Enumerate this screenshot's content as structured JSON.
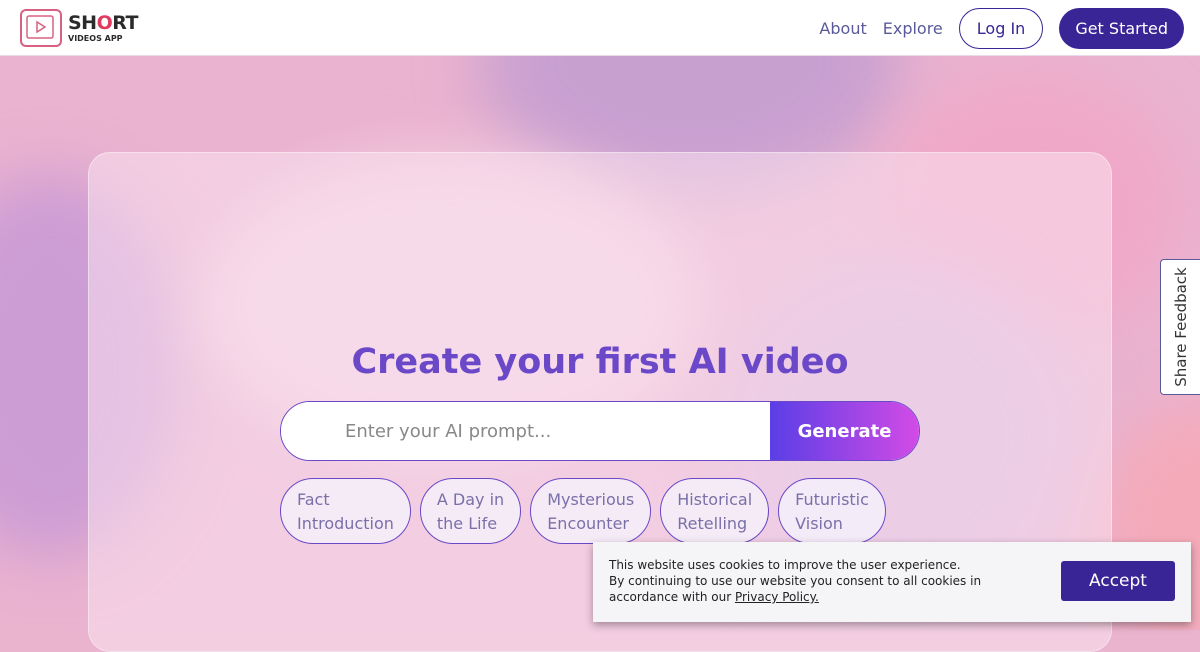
{
  "header": {
    "logo": {
      "word_main_pre": "SH",
      "word_main_accent": "O",
      "word_main_post": "RT",
      "word_sub": "VIDEOS APP"
    },
    "nav": {
      "about": "About",
      "explore": "Explore",
      "login": "Log In",
      "get_started": "Get Started"
    }
  },
  "hero": {
    "title": "Create your first AI video",
    "prompt_placeholder": "Enter your AI prompt...",
    "generate": "Generate",
    "chips": [
      "Fact\nIntroduction",
      "A Day in\nthe Life",
      "Mysterious\nEncounter",
      "Historical\nRetelling",
      "Futuristic\nVision"
    ]
  },
  "feedback": {
    "label": "Share Feedback"
  },
  "cookie": {
    "line1": "This website uses cookies to improve the user experience.",
    "line2": "By continuing to use our website you consent to all cookies in accordance with our ",
    "link": "Privacy Policy.",
    "accept": "Accept"
  },
  "colors": {
    "brand": "#3a2596",
    "accent": "#6a48c8",
    "logo_accent": "#e03a5e"
  }
}
